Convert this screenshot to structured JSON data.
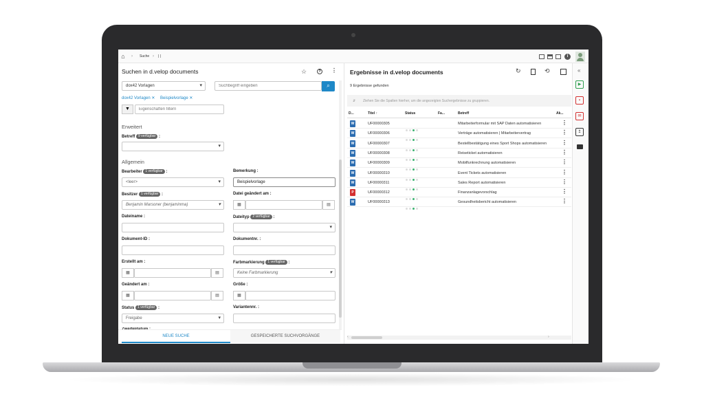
{
  "topbar": {
    "breadcrumb": "Suche",
    "breadcrumb_sep": "›",
    "breadcrumb_cursor": "| |"
  },
  "left": {
    "title": "Suchen in d.velop documents",
    "category_select": "dox42 Vorlagen",
    "search_placeholder": "Suchbegriff eingeben",
    "chips": [
      "dox42 Vorlagen",
      "Beispielvorlage"
    ],
    "filter_placeholder": "Eigenschaften filtern",
    "section_advanced": "Erweitert",
    "betreff_label": "Betreff",
    "betreff_badge": "9 verfügbar",
    "section_general": "Allgemein",
    "fields": {
      "bearbeiter": {
        "label": "Bearbeiter",
        "badge": "1 verfügbar",
        "value": "<leer>"
      },
      "bemerkung": {
        "label": "Bemerkung :",
        "value": "Beispielvorlage"
      },
      "besitzer": {
        "label": "Besitzer",
        "badge": "1 verfügbar",
        "value": "Benjamin Marsoner (benjaminma)"
      },
      "datei_geaendert": {
        "label": "Datei geändert am :"
      },
      "dateiname": {
        "label": "Dateiname :"
      },
      "dateityp": {
        "label": "Dateityp",
        "badge": "2 verfügbar"
      },
      "dokument_id": {
        "label": "Dokument-ID :"
      },
      "dokumentnr": {
        "label": "Dokumentnr. :"
      },
      "erstellt": {
        "label": "Erstellt am :"
      },
      "farbmarkierung": {
        "label": "Farbmarkierung",
        "badge": "1 verfügbar",
        "value": "Keine Farbmarkierung"
      },
      "geaendert": {
        "label": "Geändert am :"
      },
      "groesse": {
        "label": "Größe :"
      },
      "status": {
        "label": "Status",
        "badge": "1 verfügbar",
        "value": "Freigabe"
      },
      "variantennr": {
        "label": "Variantennr. :"
      },
      "zweifel": {
        "label": "Zweifeldatum :"
      }
    },
    "colon": ":",
    "tabs": [
      "NEUE SUCHE",
      "GESPEICHERTE SUCHVORGÄNGE"
    ]
  },
  "right": {
    "title": "Ergebnisse in d.velop documents",
    "count": "9 Ergebnisse gefunden",
    "group_hint": "Ziehen Sie die Spalten hierher, um die angezeigten Suchergebnisse zu gruppieren.",
    "columns": [
      "D...",
      "Titel",
      "Status",
      "Fa...",
      "Betreff",
      "Ak..."
    ],
    "rows": [
      {
        "type": "W",
        "color": "#2b6cb0",
        "id": "UF00000305",
        "subject": "Mitarbeiterformular mit SAP Daten automatisieren"
      },
      {
        "type": "W",
        "color": "#2b6cb0",
        "id": "UF00000306",
        "subject": "Verträge automatisieren | Mitarbeitervertrag"
      },
      {
        "type": "W",
        "color": "#2b6cb0",
        "id": "UF00000307",
        "subject": " Bestellbestätigung eines Sport Shops automatisieren"
      },
      {
        "type": "W",
        "color": "#2b6cb0",
        "id": "UF00000308",
        "subject": "Reiseticket automatisieren"
      },
      {
        "type": "W",
        "color": "#2b6cb0",
        "id": "UF00000309",
        "subject": "Mobilfunkrechnung automatisieren"
      },
      {
        "type": "W",
        "color": "#2b6cb0",
        "id": "UF00000310",
        "subject": "Event Tickets automatisieren"
      },
      {
        "type": "W",
        "color": "#2b6cb0",
        "id": "UF00000311",
        "subject": "Sales Report automatisieren"
      },
      {
        "type": "P",
        "color": "#d32f2f",
        "id": "UF00000312",
        "subject": "Finanzanlagevorschlag"
      },
      {
        "type": "W",
        "color": "#2b6cb0",
        "id": "UF00000313",
        "subject": "Gesundheitsbericht automatisieren"
      }
    ]
  },
  "colors": {
    "accent": "#1e88c7",
    "status_green": "#3cb371"
  }
}
